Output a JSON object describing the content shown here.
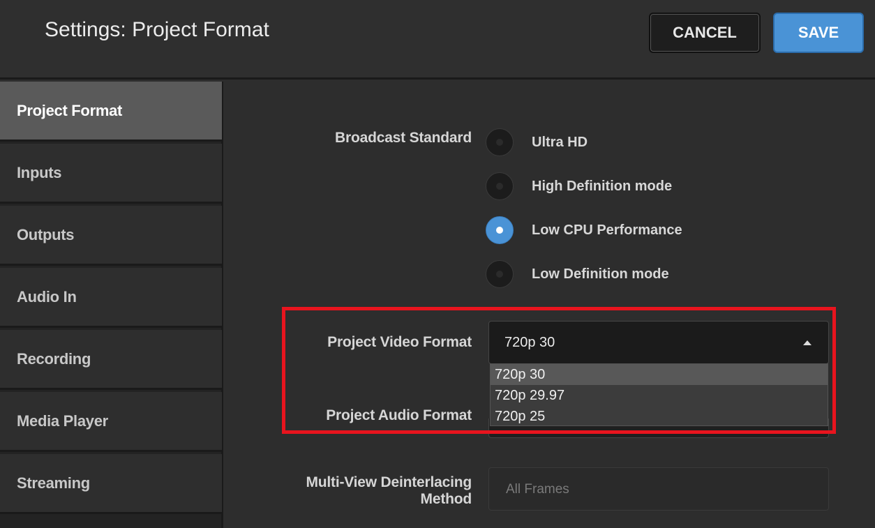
{
  "header": {
    "title": "Settings: Project Format",
    "cancel_label": "CANCEL",
    "save_label": "SAVE"
  },
  "sidebar": {
    "items": [
      {
        "label": "Project Format",
        "active": true
      },
      {
        "label": "Inputs"
      },
      {
        "label": "Outputs"
      },
      {
        "label": "Audio In"
      },
      {
        "label": "Recording"
      },
      {
        "label": "Media Player"
      },
      {
        "label": "Streaming"
      }
    ]
  },
  "broadcast": {
    "label": "Broadcast Standard",
    "options": [
      {
        "label": "Ultra HD",
        "selected": false
      },
      {
        "label": "High Definition mode",
        "selected": false
      },
      {
        "label": "Low CPU Performance",
        "selected": true
      },
      {
        "label": "Low Definition mode",
        "selected": false
      }
    ]
  },
  "video_format": {
    "label": "Project Video Format",
    "value": "720p 30",
    "options": [
      "720p 30",
      "720p 29.97",
      "720p 25"
    ]
  },
  "audio_format": {
    "label": "Project Audio Format"
  },
  "deinterlacing": {
    "label_line1": "Multi-View Deinterlacing",
    "label_line2": "Method",
    "placeholder": "All Frames"
  },
  "colors": {
    "accent": "#4a93d6",
    "highlight": "#e8141e"
  }
}
